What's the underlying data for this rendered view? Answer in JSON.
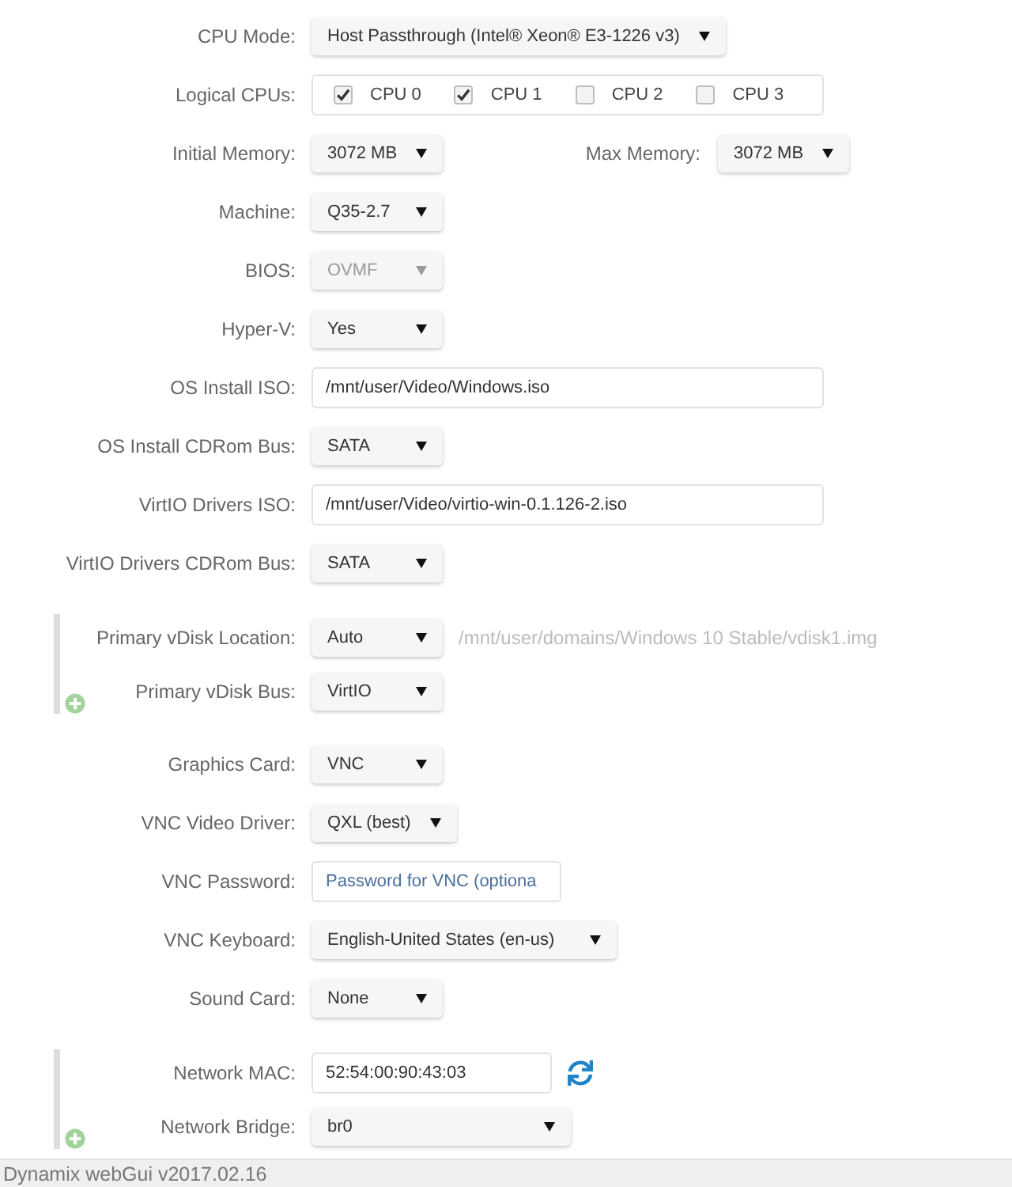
{
  "sections": [
    {
      "kind": "plain",
      "rows": [
        {
          "kind": "select",
          "label": "CPU Mode:",
          "value": "Host Passthrough (Intel® Xeon® E3-1226 v3)",
          "disabled": false
        },
        {
          "kind": "checkboxes",
          "label": "Logical CPUs:",
          "options": [
            {
              "label": "CPU 0",
              "checked": true
            },
            {
              "label": "CPU 1",
              "checked": true
            },
            {
              "label": "CPU 2",
              "checked": false
            },
            {
              "label": "CPU 3",
              "checked": false
            }
          ]
        },
        {
          "kind": "select_pair",
          "label": "Initial Memory:",
          "value": "3072 MB",
          "disabled": false,
          "second_label": "Max Memory:",
          "second_value": "3072 MB",
          "second_disabled": false
        },
        {
          "kind": "select",
          "label": "Machine:",
          "value": "Q35-2.7",
          "disabled": false
        },
        {
          "kind": "select",
          "label": "BIOS:",
          "value": "OVMF",
          "disabled": true
        },
        {
          "kind": "select",
          "label": "Hyper-V:",
          "value": "Yes",
          "disabled": false
        },
        {
          "kind": "text",
          "label": "OS Install ISO:",
          "value": "/mnt/user/Video/Windows.iso"
        },
        {
          "kind": "select",
          "label": "OS Install CDRom Bus:",
          "value": "SATA",
          "disabled": false
        },
        {
          "kind": "text",
          "label": "VirtIO Drivers ISO:",
          "value": "/mnt/user/Video/virtio-win-0.1.126-2.iso"
        },
        {
          "kind": "select",
          "label": "VirtIO Drivers CDRom Bus:",
          "value": "SATA",
          "disabled": false
        }
      ]
    },
    {
      "kind": "group",
      "rows": [
        {
          "kind": "select",
          "label": "Primary vDisk Location:",
          "value": "Auto",
          "disabled": false,
          "note": "/mnt/user/domains/Windows 10 Stable/vdisk1.img"
        },
        {
          "kind": "select",
          "label": "Primary vDisk Bus:",
          "value": "VirtIO",
          "disabled": false
        }
      ]
    },
    {
      "kind": "plain",
      "rows": [
        {
          "kind": "select",
          "label": "Graphics Card:",
          "value": "VNC",
          "disabled": false
        },
        {
          "kind": "select",
          "label": "VNC Video Driver:",
          "value": "QXL (best)",
          "disabled": false
        },
        {
          "kind": "text",
          "label": "VNC Password:",
          "placeholder": "Password for VNC (optiona"
        },
        {
          "kind": "select",
          "label": "VNC Keyboard:",
          "value": "English-United States (en-us)",
          "disabled": false
        },
        {
          "kind": "select",
          "label": "Sound Card:",
          "value": "None",
          "disabled": false
        }
      ]
    },
    {
      "kind": "group",
      "rows": [
        {
          "kind": "refreshable",
          "label": "Network MAC:",
          "value": "52:54:00:90:43:03"
        },
        {
          "kind": "select",
          "label": "Network Bridge:",
          "value": "br0",
          "disabled": false
        }
      ]
    }
  ],
  "footer": {
    "text": "Dynamix webGui v2017.02.16"
  }
}
